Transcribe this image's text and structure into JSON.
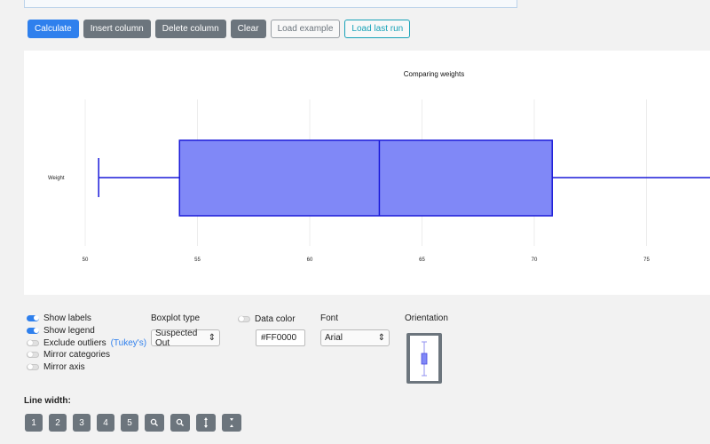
{
  "toolbar": {
    "calculate": "Calculate",
    "insert_column": "Insert column",
    "delete_column": "Delete column",
    "clear": "Clear",
    "load_example": "Load example",
    "load_last_run": "Load last run"
  },
  "chart_data": {
    "type": "boxplot",
    "title": "Comparing weights",
    "orientation": "horizontal",
    "categories": [
      "Weight"
    ],
    "boxes": [
      {
        "category": "Weight",
        "whisker_low": 50.6,
        "q1": 54.2,
        "median": 63.1,
        "q3": 70.8,
        "whisker_high": 80
      }
    ],
    "x_ticks": [
      50,
      55,
      60,
      65,
      70,
      75
    ],
    "xlim": [
      49,
      80
    ],
    "color_fill": "#8088f7",
    "color_stroke": "#1a1ad9",
    "grid": "vertical"
  },
  "options": {
    "show_labels": "Show labels",
    "show_legend": "Show legend",
    "exclude_outliers": "Exclude outliers",
    "tukey": "(Tukey's)",
    "mirror_categories": "Mirror categories",
    "mirror_axis": "Mirror axis"
  },
  "boxplot_type": {
    "label": "Boxplot type",
    "value": "Suspected Out"
  },
  "data_color": {
    "label": "Data color",
    "value": "#FF0000"
  },
  "font": {
    "label": "Font",
    "value": "Arial"
  },
  "orientation": {
    "label": "Orientation"
  },
  "line_width": {
    "title": "Line width:",
    "buttons": [
      "1",
      "2",
      "3",
      "4",
      "5"
    ],
    "zoom_in": "🔍",
    "zoom_out": "🔍",
    "increase": "↕",
    "decrease": "↕"
  }
}
